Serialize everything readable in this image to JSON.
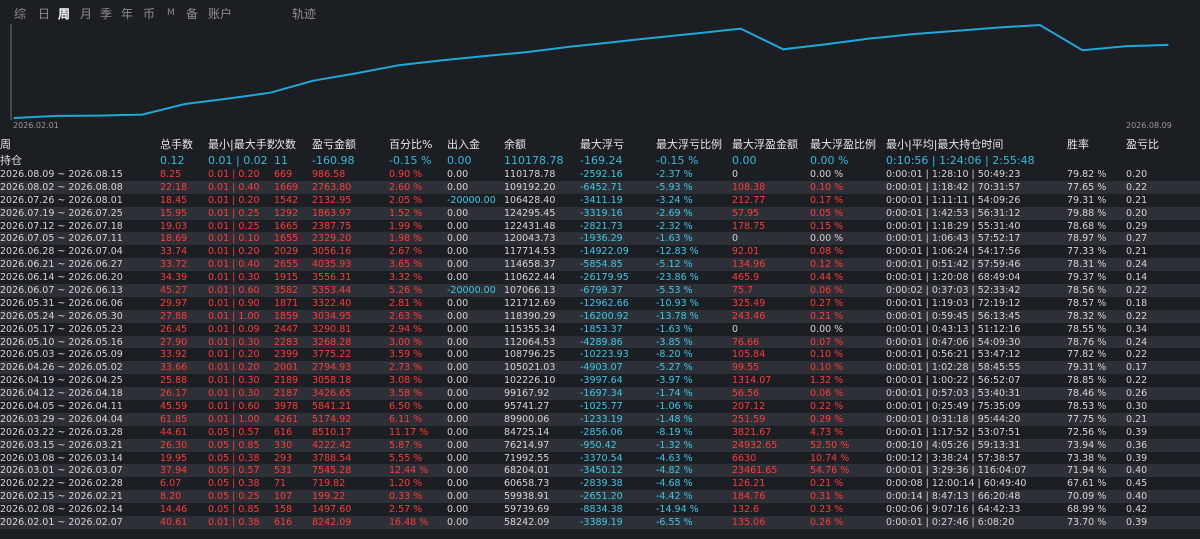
{
  "tabs": [
    {
      "label": "综",
      "active": false
    },
    {
      "label": "日",
      "active": false
    },
    {
      "label": "周",
      "active": true
    },
    {
      "label": "月",
      "active": false
    },
    {
      "label": "季",
      "active": false
    },
    {
      "label": "年",
      "active": false
    },
    {
      "label": "币",
      "active": false
    },
    {
      "label": "M",
      "active": false
    },
    {
      "label": "备",
      "active": false
    },
    {
      "label": "账户",
      "active": false
    },
    {
      "label": "轨迹",
      "active": false
    }
  ],
  "chart_data": {
    "type": "line",
    "x_start": "2026.02.01",
    "x_end": "2026.08.09",
    "line_color": "#1fa8d8",
    "background": "#1b1e22",
    "series": [
      {
        "values": [
          58242.09,
          59739.69,
          59938.91,
          60658.73,
          68204.01,
          71992.55,
          76214.97,
          84725.14,
          89900.06,
          95741.27,
          99167.92,
          102226.1,
          105021.03,
          108796.25,
          112064.53,
          115355.34,
          118390.29,
          121712.69,
          107066.13,
          110622.44,
          114658.37,
          117714.53,
          120043.73,
          122431.48,
          124295.45,
          106428.4,
          109192.2,
          110178.78
        ]
      }
    ]
  },
  "columns": [
    "周",
    "总手数",
    "最小|最大手数",
    "次数",
    "盈亏金额",
    "百分比%",
    "出入金",
    "余额",
    "最大浮亏",
    "最大浮亏比例",
    "最大浮盈金额",
    "最大浮盈比例",
    "最小|平均|最大持仓时间",
    "胜率",
    "盈亏比"
  ],
  "position": [
    "持仓",
    "0.12",
    "0.01 | 0.02",
    "11",
    "-160.98",
    "-0.15 %",
    "0.00",
    "110178.78",
    "-169.24",
    "-0.15 %",
    "0.00",
    "0.00 %",
    "0:10:56 | 1:24:06 | 2:55:48",
    "",
    ""
  ],
  "rows": [
    [
      "2026.08.09 ~ 2026.08.15",
      "8.25",
      "0.01 | 0.20",
      "669",
      "986.58",
      "0.90 %",
      "0.00",
      "110178.78",
      "-2592.16",
      "-2.37 %",
      "0",
      "0.00 %",
      "0:00:01 | 1:28:10 | 50:49:23",
      "79.82 %",
      "0.20"
    ],
    [
      "2026.08.02 ~ 2026.08.08",
      "22.18",
      "0.01 | 0.40",
      "1669",
      "2763.80",
      "2.60 %",
      "0.00",
      "109192.20",
      "-6452.71",
      "-5.93 %",
      "108.38",
      "0.10 %",
      "0:00:01 | 1:18:42 | 70:31:57",
      "77.65 %",
      "0.22"
    ],
    [
      "2026.07.26 ~ 2026.08.01",
      "18.45",
      "0.01 | 0.20",
      "1542",
      "2132.95",
      "2.05 %",
      "-20000.00",
      "106428.40",
      "-3411.19",
      "-3.24 %",
      "212.77",
      "0.17 %",
      "0:00:01 | 1:11:11 | 54:09:26",
      "79.31 %",
      "0.21"
    ],
    [
      "2026.07.19 ~ 2026.07.25",
      "15.95",
      "0.01 | 0.25",
      "1292",
      "1863.97",
      "1.52 %",
      "0.00",
      "124295.45",
      "-3319.16",
      "-2.69 %",
      "57.95",
      "0.05 %",
      "0:00:01 | 1:42:53 | 56:31:12",
      "79.88 %",
      "0.20"
    ],
    [
      "2026.07.12 ~ 2026.07.18",
      "19.03",
      "0.01 | 0.25",
      "1665",
      "2387.75",
      "1.99 %",
      "0.00",
      "122431.48",
      "-2821.73",
      "-2.32 %",
      "178.75",
      "0.15 %",
      "0:00:01 | 1:18:29 | 55:31:40",
      "78.68 %",
      "0.29"
    ],
    [
      "2026.07.05 ~ 2026.07.11",
      "18.69",
      "0.01 | 0.10",
      "1655",
      "2329.20",
      "1.98 %",
      "0.00",
      "120043.73",
      "-1936.29",
      "-1.63 %",
      "0",
      "0.00 %",
      "0:00:01 | 1:06:43 | 57:52:17",
      "78.97 %",
      "0.27"
    ],
    [
      "2026.06.28 ~ 2026.07.04",
      "33.74",
      "0.01 | 0.20",
      "2029",
      "3056.16",
      "2.67 %",
      "0.00",
      "117714.53",
      "-14922.09",
      "-12.83 %",
      "92.01",
      "0.08 %",
      "0:00:01 | 1:06:24 | 54:17:56",
      "77.33 %",
      "0.21"
    ],
    [
      "2026.06.21 ~ 2026.06.27",
      "33.72",
      "0.01 | 0.40",
      "2655",
      "4035.93",
      "3.65 %",
      "0.00",
      "114658.37",
      "-5854.85",
      "-5.12 %",
      "134.96",
      "0.12 %",
      "0:00:01 | 0:51:42 | 57:59:46",
      "78.31 %",
      "0.24"
    ],
    [
      "2026.06.14 ~ 2026.06.20",
      "34.39",
      "0.01 | 0.30",
      "1915",
      "3556.31",
      "3.32 %",
      "0.00",
      "110622.44",
      "-26179.95",
      "-23.86 %",
      "465.9",
      "0.44 %",
      "0:00:01 | 1:20:08 | 68:49:04",
      "79.37 %",
      "0.14"
    ],
    [
      "2026.06.07 ~ 2026.06.13",
      "45.27",
      "0.01 | 0.60",
      "3582",
      "5353.44",
      "5.26 %",
      "-20000.00",
      "107066.13",
      "-6799.37",
      "-5.53 %",
      "75.7",
      "0.06 %",
      "0:00:02 | 0:37:03 | 52:33:42",
      "78.56 %",
      "0.22"
    ],
    [
      "2026.05.31 ~ 2026.06.06",
      "29.97",
      "0.01 | 0.90",
      "1871",
      "3322.40",
      "2.81 %",
      "0.00",
      "121712.69",
      "-12962.66",
      "-10.93 %",
      "325.49",
      "0.27 %",
      "0:00:01 | 1:19:03 | 72:19:12",
      "78.57 %",
      "0.18"
    ],
    [
      "2026.05.24 ~ 2026.05.30",
      "27.88",
      "0.01 | 1.00",
      "1859",
      "3034.95",
      "2.63 %",
      "0.00",
      "118390.29",
      "-16200.92",
      "-13.78 %",
      "243.46",
      "0.21 %",
      "0:00:01 | 0:59:45 | 56:13:45",
      "78.32 %",
      "0.22"
    ],
    [
      "2026.05.17 ~ 2026.05.23",
      "26.45",
      "0.01 | 0.09",
      "2447",
      "3290.81",
      "2.94 %",
      "0.00",
      "115355.34",
      "-1853.37",
      "-1.63 %",
      "0",
      "0.00 %",
      "0:00:01 | 0:43:13 | 51:12:16",
      "78.55 %",
      "0.34"
    ],
    [
      "2026.05.10 ~ 2026.05.16",
      "27.90",
      "0.01 | 0.30",
      "2283",
      "3268.28",
      "3.00 %",
      "0.00",
      "112064.53",
      "-4289.86",
      "-3.85 %",
      "76.66",
      "0.07 %",
      "0:00:01 | 0:47:06 | 54:09:30",
      "78.76 %",
      "0.24"
    ],
    [
      "2026.05.03 ~ 2026.05.09",
      "33.92",
      "0.01 | 0.20",
      "2399",
      "3775.22",
      "3.59 %",
      "0.00",
      "108796.25",
      "-10223.93",
      "-8.20 %",
      "105.84",
      "0.10 %",
      "0:00:01 | 0:56:21 | 53:47:12",
      "77.82 %",
      "0.22"
    ],
    [
      "2026.04.26 ~ 2026.05.02",
      "33.66",
      "0.01 | 0.20",
      "2001",
      "2794.93",
      "2.73 %",
      "0.00",
      "105021.03",
      "-4903.07",
      "-5.27 %",
      "99.55",
      "0.10 %",
      "0:00:01 | 1:02:28 | 58:45:55",
      "79.31 %",
      "0.17"
    ],
    [
      "2026.04.19 ~ 2026.04.25",
      "25.88",
      "0.01 | 0.30",
      "2189",
      "3058.18",
      "3.08 %",
      "0.00",
      "102226.10",
      "-3997.64",
      "-3.97 %",
      "1314.07",
      "1.32 %",
      "0:00:01 | 1:00:22 | 56:52:07",
      "78.85 %",
      "0.22"
    ],
    [
      "2026.04.12 ~ 2026.04.18",
      "26.17",
      "0.01 | 0.30",
      "2187",
      "3426.65",
      "3.58 %",
      "0.00",
      "99167.92",
      "-1697.34",
      "-1.74 %",
      "56.56",
      "0.06 %",
      "0:00:01 | 0:57:03 | 53:40:31",
      "78.46 %",
      "0.26"
    ],
    [
      "2026.04.05 ~ 2026.04.11",
      "45.59",
      "0.01 | 0.60",
      "3978",
      "5841.21",
      "6.50 %",
      "0.00",
      "95741.27",
      "-1025.77",
      "-1.06 %",
      "207.12",
      "0.22 %",
      "0:00:01 | 0:25:49 | 75:35:09",
      "78.53 %",
      "0.30"
    ],
    [
      "2026.03.29 ~ 2026.04.04",
      "61.85",
      "0.01 | 1.00",
      "4261",
      "5174.92",
      "6.11 %",
      "0.00",
      "89900.06",
      "-1233.19",
      "-1.48 %",
      "251.59",
      "0.29 %",
      "0:00:01 | 0:31:18 | 95:44:20",
      "77.75 %",
      "0.21"
    ],
    [
      "2026.03.22 ~ 2026.03.28",
      "44.61",
      "0.05 | 0.57",
      "616",
      "8510.17",
      "11.17 %",
      "0.00",
      "84725.14",
      "-2856.06",
      "-8.19 %",
      "3821.67",
      "4.73 %",
      "0:00:01 | 1:17:52 | 53:07:51",
      "72.56 %",
      "0.39"
    ],
    [
      "2026.03.15 ~ 2026.03.21",
      "26.30",
      "0.05 | 0.85",
      "330",
      "4222.42",
      "5.87 %",
      "0.00",
      "76214.97",
      "-950.42",
      "-1.32 %",
      "24932.65",
      "52.50 %",
      "0:00:10 | 4:05:26 | 59:13:31",
      "73.94 %",
      "0.36"
    ],
    [
      "2026.03.08 ~ 2026.03.14",
      "19.95",
      "0.05 | 0.38",
      "293",
      "3788.54",
      "5.55 %",
      "0.00",
      "71992.55",
      "-3370.54",
      "-4.63 %",
      "6630",
      "10.74 %",
      "0:00:12 | 3:38:24 | 57:38:57",
      "73.38 %",
      "0.39"
    ],
    [
      "2026.03.01 ~ 2026.03.07",
      "37.94",
      "0.05 | 0.57",
      "531",
      "7545.28",
      "12.44 %",
      "0.00",
      "68204.01",
      "-3450.12",
      "-4.82 %",
      "23461.65",
      "54.76 %",
      "0:00:01 | 3:29:36 | 116:04:07",
      "71.94 %",
      "0.40"
    ],
    [
      "2026.02.22 ~ 2026.02.28",
      "6.07",
      "0.05 | 0.38",
      "71",
      "719.82",
      "1.20 %",
      "0.00",
      "60658.73",
      "-2839.38",
      "-4.68 %",
      "126.21",
      "0.21 %",
      "0:00:08 | 12:00:14 | 60:49:40",
      "67.61 %",
      "0.45"
    ],
    [
      "2026.02.15 ~ 2026.02.21",
      "8.20",
      "0.05 | 0.25",
      "107",
      "199.22",
      "0.33 %",
      "0.00",
      "59938.91",
      "-2651.20",
      "-4.42 %",
      "184.76",
      "0.31 %",
      "0:00:14 | 8:47:13 | 66:20:48",
      "70.09 %",
      "0.40"
    ],
    [
      "2026.02.08 ~ 2026.02.14",
      "14.46",
      "0.05 | 0.85",
      "158",
      "1497.60",
      "2.57 %",
      "0.00",
      "59739.69",
      "-8834.38",
      "-14.94 %",
      "132.6",
      "0.23 %",
      "0:00:06 | 9:07:16 | 64:42:33",
      "68.99 %",
      "0.42"
    ],
    [
      "2026.02.01 ~ 2026.02.07",
      "40.61",
      "0.01 | 0.38",
      "616",
      "8242.09",
      "16.48 %",
      "0.00",
      "58242.09",
      "-3389.19",
      "-6.55 %",
      "135.06",
      "0.26 %",
      "0:00:01 | 0:27:46 | 6:08:20",
      "73.70 %",
      "0.39"
    ]
  ]
}
